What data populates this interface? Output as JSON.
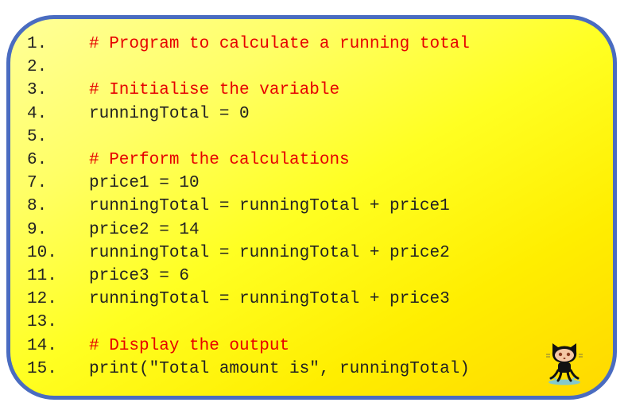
{
  "code": {
    "lines": [
      {
        "num": "1.",
        "text": "# Program to calculate a running total",
        "kind": "comment"
      },
      {
        "num": "2.",
        "text": "",
        "kind": "plain"
      },
      {
        "num": "3.",
        "text": "# Initialise the variable",
        "kind": "comment"
      },
      {
        "num": "4.",
        "text": "runningTotal = 0",
        "kind": "plain"
      },
      {
        "num": "5.",
        "text": "",
        "kind": "plain"
      },
      {
        "num": "6.",
        "text": "# Perform the calculations",
        "kind": "comment"
      },
      {
        "num": "7.",
        "text": "price1 = 10",
        "kind": "plain"
      },
      {
        "num": "8.",
        "text": "runningTotal = runningTotal + price1",
        "kind": "plain"
      },
      {
        "num": "9.",
        "text": "price2 = 14",
        "kind": "plain"
      },
      {
        "num": "10.",
        "text": "runningTotal = runningTotal + price2",
        "kind": "plain"
      },
      {
        "num": "11.",
        "text": "price3 = 6",
        "kind": "plain"
      },
      {
        "num": "12.",
        "text": "runningTotal = runningTotal + price3",
        "kind": "plain"
      },
      {
        "num": "13.",
        "text": "",
        "kind": "plain"
      },
      {
        "num": "14.",
        "text": "# Display the output",
        "kind": "comment"
      },
      {
        "num": "15.",
        "text": "print(\"Total amount is\", runningTotal)",
        "kind": "plain"
      }
    ]
  },
  "colors": {
    "border": "#4a6cc0",
    "comment": "#e60000",
    "code": "#222222",
    "background_light": "#ffff99",
    "background_dark": "#ffd800"
  },
  "mascot": {
    "icon": "octocat-icon"
  }
}
